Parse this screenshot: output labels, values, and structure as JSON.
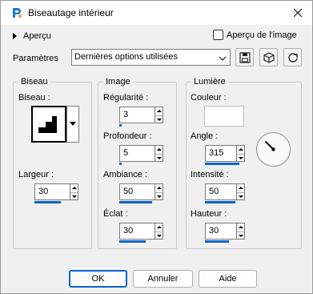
{
  "window": {
    "title": "Biseautage intérieur"
  },
  "preview": {
    "label": "Aperçu",
    "image_preview_label": "Aperçu de l'image"
  },
  "presets": {
    "label": "Paramètres",
    "value": "Dernières options utilisées"
  },
  "bevel_group": {
    "title": "Biseau",
    "bevel_label": "Biseau :",
    "width_label": "Largeur :",
    "width_value": "30",
    "width_fill_fraction": 0.6
  },
  "image_group": {
    "title": "Image",
    "fields": [
      {
        "label": "Régularité :",
        "value": "3",
        "fill_fraction": 0.05
      },
      {
        "label": "Profondeur :",
        "value": "5",
        "fill_fraction": 0.05
      },
      {
        "label": "Ambiance :",
        "value": "50",
        "fill_fraction": 0.75
      },
      {
        "label": "Éclat :",
        "value": "30",
        "fill_fraction": 0.6
      }
    ]
  },
  "light_group": {
    "title": "Lumière",
    "color_label": "Couleur :",
    "color_value": "#ffffff",
    "angle_label": "Angle :",
    "angle_value": "315",
    "angle_fill_fraction": 0.85,
    "intensity_label": "Intensité :",
    "intensity_value": "50",
    "intensity_fill_fraction": 0.75,
    "height_label": "Hauteur :",
    "height_value": "30",
    "height_fill_fraction": 0.6
  },
  "buttons": {
    "ok": "OK",
    "cancel": "Annuler",
    "help": "Aide"
  },
  "colors": {
    "accent": "#0a64c8",
    "dialog_bg": "#f0f0f0"
  }
}
